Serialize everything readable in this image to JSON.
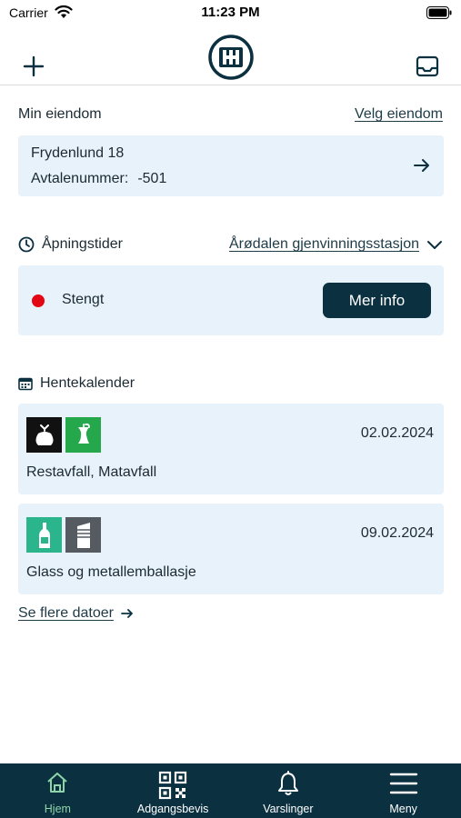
{
  "status_bar": {
    "carrier": "Carrier",
    "time": "11:23 PM"
  },
  "nav": {
    "add_icon": "plus-icon",
    "logo_icon": "app-logo",
    "inbox_icon": "inbox-icon"
  },
  "property": {
    "heading": "Min eiendom",
    "select_link": "Velg eiendom",
    "address": "Frydenlund 18",
    "agreement_label": "Avtalenummer:",
    "agreement_number": "-501"
  },
  "opening_hours": {
    "heading": "Åpningstider",
    "station": "Årødalen gjenvinningsstasjon",
    "status": "Stengt",
    "status_color": "#e30613",
    "more_info_button": "Mer info"
  },
  "pickup_calendar": {
    "heading": "Hentekalender",
    "entries": [
      {
        "date": "02.02.2024",
        "description": "Restavfall, Matavfall",
        "icons": [
          "residual-waste-bag-icon",
          "food-waste-apple-icon"
        ],
        "icon_colors": [
          "#111111",
          "#25a84b"
        ]
      },
      {
        "date": "09.02.2024",
        "description": "Glass og metallemballasje",
        "icons": [
          "glass-bottle-icon",
          "metal-can-icon"
        ],
        "icon_colors": [
          "#2bb58c",
          "#555b60"
        ]
      }
    ],
    "more_dates_link": "Se flere datoer"
  },
  "tab_bar": {
    "tabs": [
      {
        "label": "Hjem",
        "icon": "home-icon",
        "active": true
      },
      {
        "label": "Adgangsbevis",
        "icon": "qr-code-icon",
        "active": false
      },
      {
        "label": "Varslinger",
        "icon": "bell-icon",
        "active": false
      },
      {
        "label": "Meny",
        "icon": "menu-icon",
        "active": false
      }
    ],
    "background": "#0b3040",
    "active_color": "#8fd3a8"
  }
}
